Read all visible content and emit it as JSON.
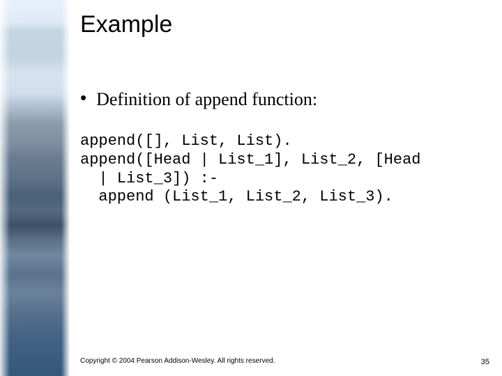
{
  "title": "Example",
  "bullet": "Definition of append function:",
  "code": "append([], List, List).\nappend([Head | List_1], List_2, [Head\n  | List_3]) :-\n  append (List_1, List_2, List_3).",
  "copyright": "Copyright © 2004 Pearson Addison-Wesley. All rights reserved.",
  "page_number": "35"
}
